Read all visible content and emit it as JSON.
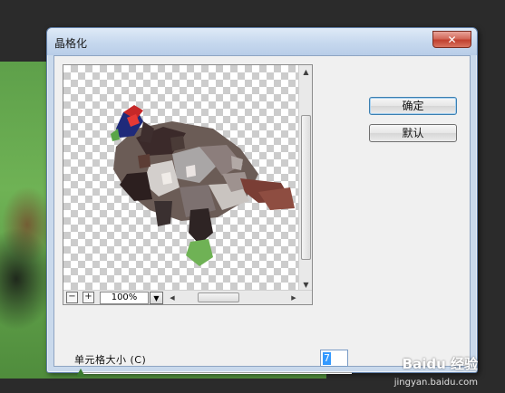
{
  "dialog": {
    "title": "晶格化",
    "close_symbol": "✕"
  },
  "buttons": {
    "ok_label": "确定",
    "reset_label": "默认"
  },
  "preview": {
    "zoom_value": "100%",
    "zoom_out_symbol": "−",
    "zoom_in_symbol": "+",
    "content": "pheasant-crystallized"
  },
  "cell_size": {
    "label": "单元格大小 (C)",
    "value": "7",
    "slider_position": 0.0
  },
  "watermark": {
    "brand": "Baidu 经验",
    "url": "jingyan.baidu.com"
  },
  "colors": {
    "title_bar": "#c6d8ee",
    "close_button": "#c0402f",
    "window_body": "#f0f0f0",
    "accent_selection": "#3399ff"
  },
  "icons": {
    "close": "close-icon",
    "zoom_out": "minus-icon",
    "zoom_in": "plus-icon",
    "dropdown": "chevron-down-icon",
    "scroll_up": "arrow-up-icon",
    "scroll_down": "arrow-down-icon",
    "scroll_left": "arrow-left-icon",
    "scroll_right": "arrow-right-icon"
  }
}
